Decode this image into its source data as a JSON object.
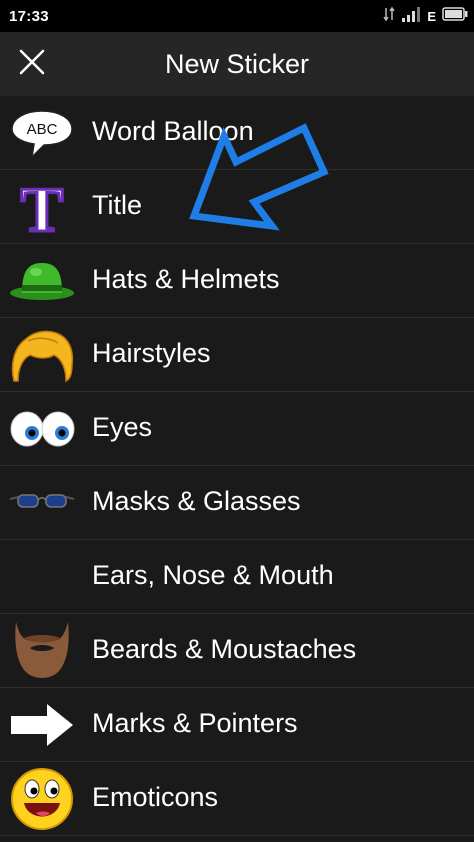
{
  "status_bar": {
    "time": "17:33",
    "carrier": "E",
    "icons": [
      "data-transfer-icon",
      "signal-icon",
      "battery-icon"
    ]
  },
  "header": {
    "title": "New Sticker",
    "close_icon": "close-icon"
  },
  "categories": [
    {
      "label": "Word Balloon",
      "icon": "word-balloon-icon",
      "icon_text": "ABC"
    },
    {
      "label": "Title",
      "icon": "title-icon",
      "icon_text": "T"
    },
    {
      "label": "Hats & Helmets",
      "icon": "hat-icon"
    },
    {
      "label": "Hairstyles",
      "icon": "hairstyle-icon"
    },
    {
      "label": "Eyes",
      "icon": "eyes-icon"
    },
    {
      "label": "Masks & Glasses",
      "icon": "glasses-icon"
    },
    {
      "label": "Ears, Nose & Mouth",
      "icon": ""
    },
    {
      "label": "Beards & Moustaches",
      "icon": "beard-icon"
    },
    {
      "label": "Marks & Pointers",
      "icon": "arrow-pointer-icon"
    },
    {
      "label": "Emoticons",
      "icon": "smiley-icon"
    }
  ],
  "colors": {
    "background": "#1a1a1a",
    "app_bar": "#262626",
    "status_bar": "#000000",
    "annotation": "#1e7ee6"
  }
}
